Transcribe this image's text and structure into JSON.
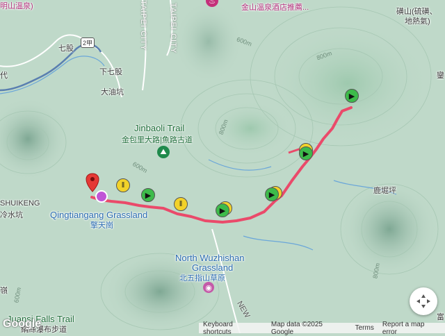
{
  "places": {
    "qiqu": "七股",
    "xiaqiqu": "下七股",
    "dayoukeng": "大油坑",
    "jinbaoli_en": "Jinbaoli Trail",
    "jinbaoli_zh": "金包里大路|魚路古道",
    "shuikeng_en": "SHUIKENG",
    "shuikeng_zh": "冷水坑",
    "qingtiangang_en": "Qingtiangang Grassland",
    "qingtiangang_zh": "擎天崗",
    "luku": "鹿堀坪",
    "wuzhishan_en": "North Wuzhishan",
    "wuzhishan_en2": "Grassland",
    "wuzhishan_zh": "北五指山草原",
    "jinshan_hotel": "金山溫泉酒店推薦...",
    "huangshan": "磺山(硫磺、",
    "huangshan2": "地熱氣)",
    "juansi": "Juansi Falls Trail",
    "juansi_zh": "絹絲瀑布步道",
    "lin": "嶺",
    "dai": "代",
    "dong": "富",
    "mountain": "明山溫泉)",
    "taipei_city1": "TAIPEI CITY",
    "taipei_city2": "TAIPEI CITY",
    "road_new": "NEW",
    "route_2jia": "2甲",
    "tu": "鑾"
  },
  "contours": [
    "600m",
    "800m",
    "800m",
    "800m",
    "600m",
    "600m"
  ],
  "attribution": {
    "shortcuts": "Keyboard shortcuts",
    "mapdata": "Map data ©2025 Google",
    "terms": "Terms",
    "report": "Report a map error"
  },
  "logo": "Google",
  "icons": {
    "compass": "compass-icon",
    "trail": "hiker-icon",
    "grassland": "camera-icon",
    "hotel": "hotel-icon"
  },
  "colors": {
    "track": "#ea4a6a",
    "flag_green": "#3dbb4a",
    "flag_yellow": "#f2d22a",
    "start_pin": "#e53935"
  }
}
